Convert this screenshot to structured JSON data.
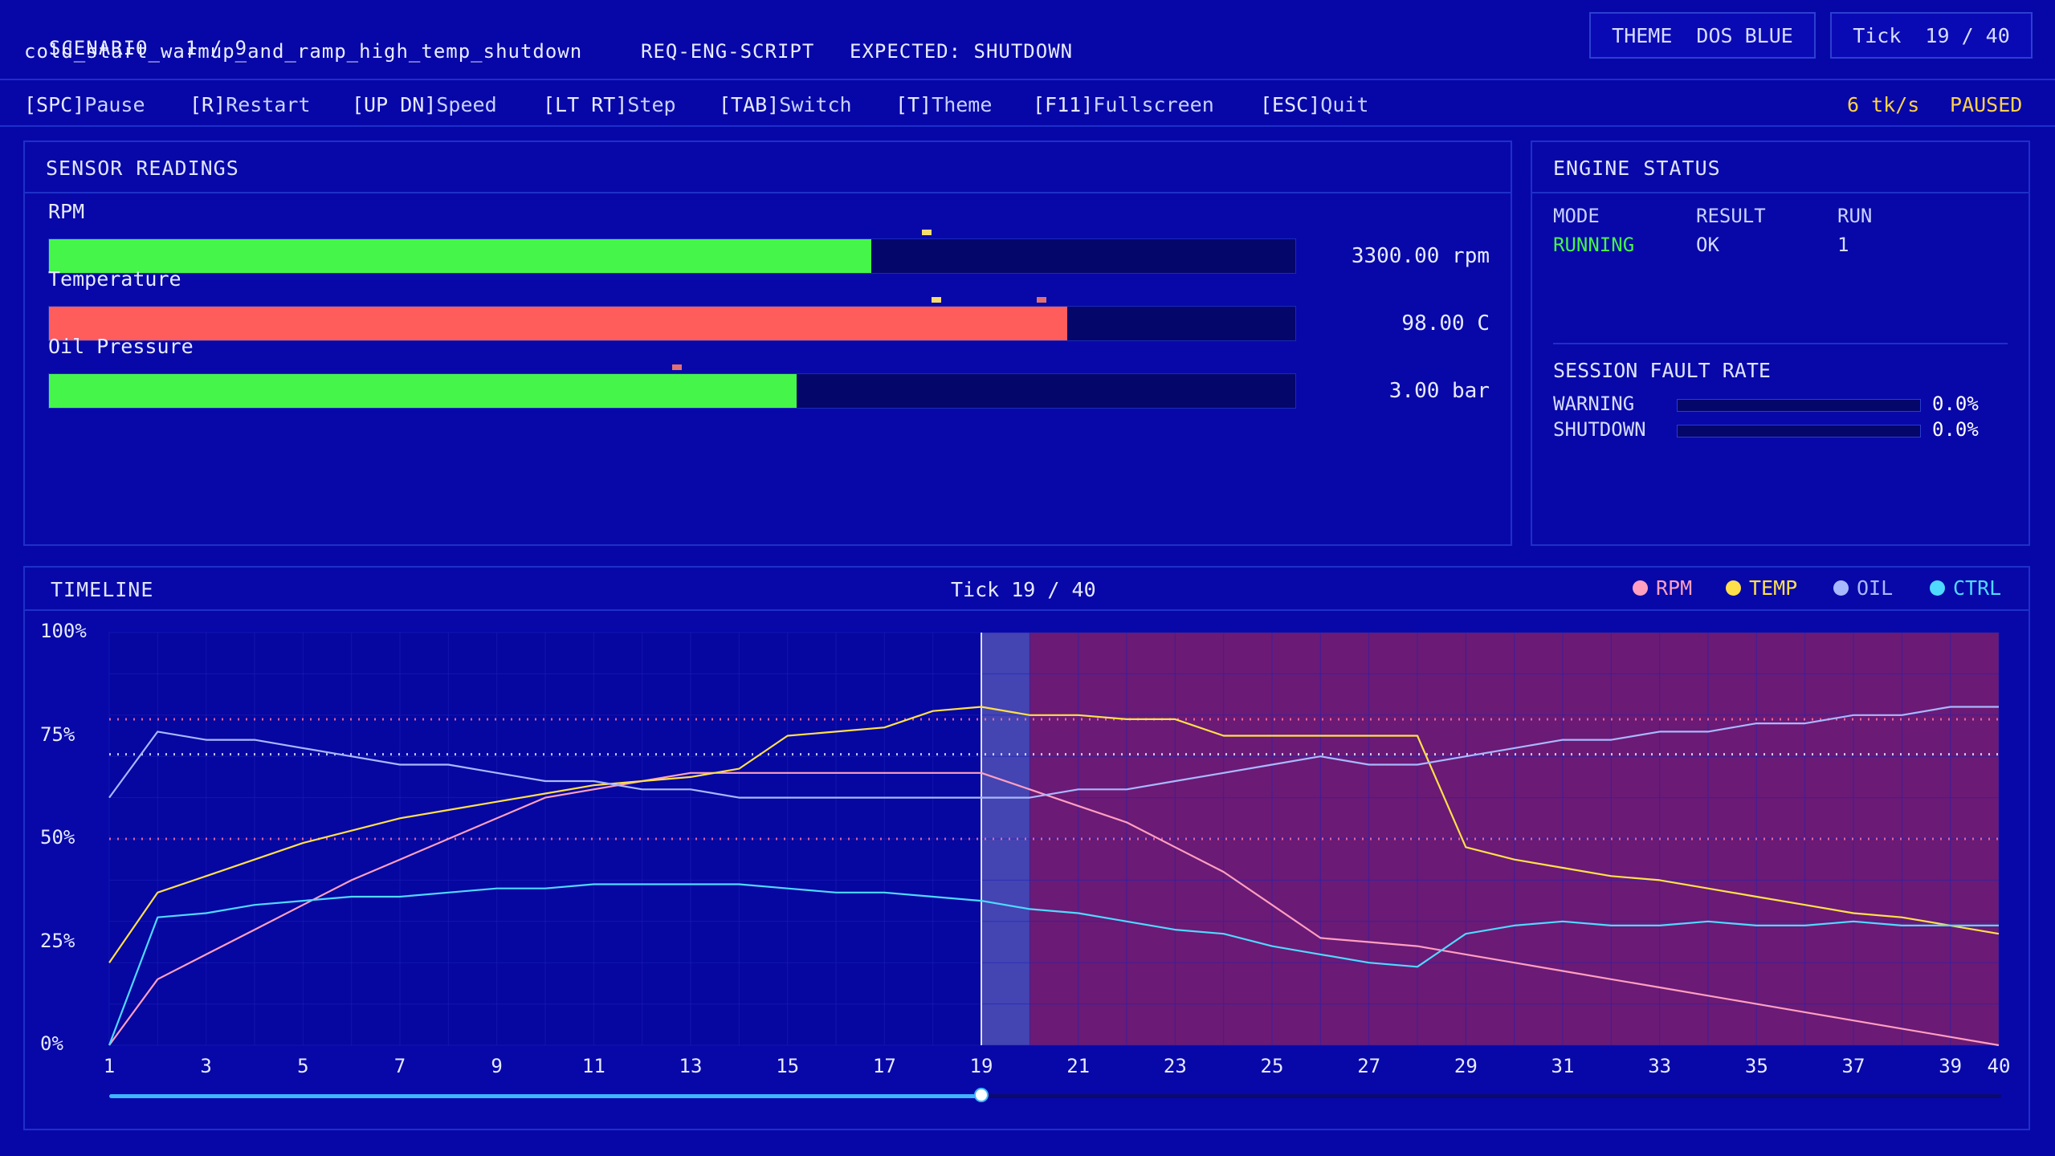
{
  "header": {
    "scenario_label": "SCENARIO",
    "scenario_index": "1 / 9",
    "scenario_name": "cold_start_warmup_and_ramp_high_temp_shutdown",
    "req_id": "REQ-ENG-SCRIPT",
    "expected": "EXPECTED: SHUTDOWN",
    "theme_label": "THEME",
    "theme_value": "DOS BLUE",
    "tick_label": "Tick",
    "tick_value": "19 / 40"
  },
  "keybar": {
    "items": [
      {
        "key": "[SPC]",
        "action": "Pause"
      },
      {
        "key": "[R]",
        "action": "Restart"
      },
      {
        "key": "[UP DN]",
        "action": "Speed"
      },
      {
        "key": "[LT RT]",
        "action": "Step"
      },
      {
        "key": "[TAB]",
        "action": "Switch"
      },
      {
        "key": "[T]",
        "action": "Theme"
      },
      {
        "key": "[F11]",
        "action": "Fullscreen"
      },
      {
        "key": "[ESC]",
        "action": "Quit"
      }
    ],
    "speed": "6 tk/s",
    "state": "PAUSED"
  },
  "sensors": {
    "title": "SENSOR READINGS",
    "items": [
      {
        "label": "RPM",
        "value": "3300.00 rpm",
        "fill_fraction": 0.66,
        "color": "#46f54a",
        "markers": [
          {
            "at": 0.7,
            "color": "#f5dc6e"
          }
        ]
      },
      {
        "label": "Temperature",
        "value": "98.00 C",
        "fill_fraction": 0.817,
        "color": "#ff5c5c",
        "markers": [
          {
            "at": 0.708,
            "color": "#f5dc6e"
          },
          {
            "at": 0.792,
            "color": "#e07070"
          }
        ]
      },
      {
        "label": "Oil Pressure",
        "value": "3.00 bar",
        "fill_fraction": 0.6,
        "color": "#46f54a",
        "markers": [
          {
            "at": 0.5,
            "color": "#e07070"
          }
        ]
      }
    ]
  },
  "engine": {
    "title": "ENGINE STATUS",
    "mode_head": "MODE",
    "result_head": "RESULT",
    "run_head": "RUN",
    "mode": "RUNNING",
    "result": "OK",
    "run": "1",
    "fault_title": "SESSION FAULT RATE",
    "faults": [
      {
        "label": "WARNING",
        "value": "0.0%",
        "fraction": 0.0
      },
      {
        "label": "SHUTDOWN",
        "value": "0.0%",
        "fraction": 0.0
      }
    ]
  },
  "timeline": {
    "title": "TIMELINE",
    "tick_text": "Tick 19 / 40",
    "legend": [
      {
        "name": "RPM",
        "color": "#ff9fc0"
      },
      {
        "name": "TEMP",
        "color": "#ffe04a"
      },
      {
        "name": "OIL",
        "color": "#a8b8ff"
      },
      {
        "name": "CTRL",
        "color": "#4fd9ff"
      }
    ]
  },
  "chart_data": {
    "type": "line",
    "x": [
      1,
      2,
      3,
      4,
      5,
      6,
      7,
      8,
      9,
      10,
      11,
      12,
      13,
      14,
      15,
      16,
      17,
      18,
      19,
      20,
      21,
      22,
      23,
      24,
      25,
      26,
      27,
      28,
      29,
      30,
      31,
      32,
      33,
      34,
      35,
      36,
      37,
      38,
      39,
      40
    ],
    "x_ticks": [
      "1",
      "3",
      "5",
      "7",
      "9",
      "11",
      "13",
      "15",
      "17",
      "19",
      "21",
      "23",
      "25",
      "27",
      "29",
      "31",
      "33",
      "35",
      "37",
      "39",
      "40"
    ],
    "y_ticks": [
      "0%",
      "25%",
      "50%",
      "75%",
      "100%"
    ],
    "ylim": [
      0,
      100
    ],
    "current_tick": 19,
    "threshold_lines": [
      {
        "y": 79,
        "color": "#ff6fa0"
      },
      {
        "y": 70.5,
        "color": "#e8e8ff"
      },
      {
        "y": 50,
        "color": "#ff6fa0"
      }
    ],
    "shaded_region": {
      "from": 20,
      "to": 40,
      "color": "#7a1e6e"
    },
    "series": [
      {
        "name": "RPM",
        "color": "#ff9fc0",
        "values": [
          0,
          16,
          22,
          28,
          34,
          40,
          45,
          50,
          55,
          60,
          62,
          64,
          66,
          66,
          66,
          66,
          66,
          66,
          66,
          62,
          58,
          54,
          48,
          42,
          34,
          26,
          25,
          24,
          22,
          20,
          18,
          16,
          14,
          12,
          10,
          8,
          6,
          4,
          2,
          0
        ]
      },
      {
        "name": "TEMP",
        "color": "#ffe04a",
        "values": [
          20,
          37,
          41,
          45,
          49,
          52,
          55,
          57,
          59,
          61,
          63,
          64,
          65,
          67,
          75,
          76,
          77,
          81,
          82,
          80,
          80,
          79,
          79,
          75,
          75,
          75,
          75,
          75,
          48,
          45,
          43,
          41,
          40,
          38,
          36,
          34,
          32,
          31,
          29,
          27
        ]
      },
      {
        "name": "OIL",
        "color": "#a8b8ff",
        "values": [
          60,
          76,
          74,
          74,
          72,
          70,
          68,
          68,
          66,
          64,
          64,
          62,
          62,
          60,
          60,
          60,
          60,
          60,
          60,
          60,
          62,
          62,
          64,
          66,
          68,
          70,
          68,
          68,
          70,
          72,
          74,
          74,
          76,
          76,
          78,
          78,
          80,
          80,
          82,
          82
        ]
      },
      {
        "name": "CTRL",
        "color": "#4fd9ff",
        "values": [
          0,
          31,
          32,
          34,
          35,
          36,
          36,
          37,
          38,
          38,
          39,
          39,
          39,
          39,
          38,
          37,
          37,
          36,
          35,
          33,
          32,
          30,
          28,
          27,
          24,
          22,
          20,
          19,
          27,
          29,
          30,
          29,
          29,
          30,
          29,
          29,
          30,
          29,
          29,
          29
        ]
      }
    ]
  }
}
